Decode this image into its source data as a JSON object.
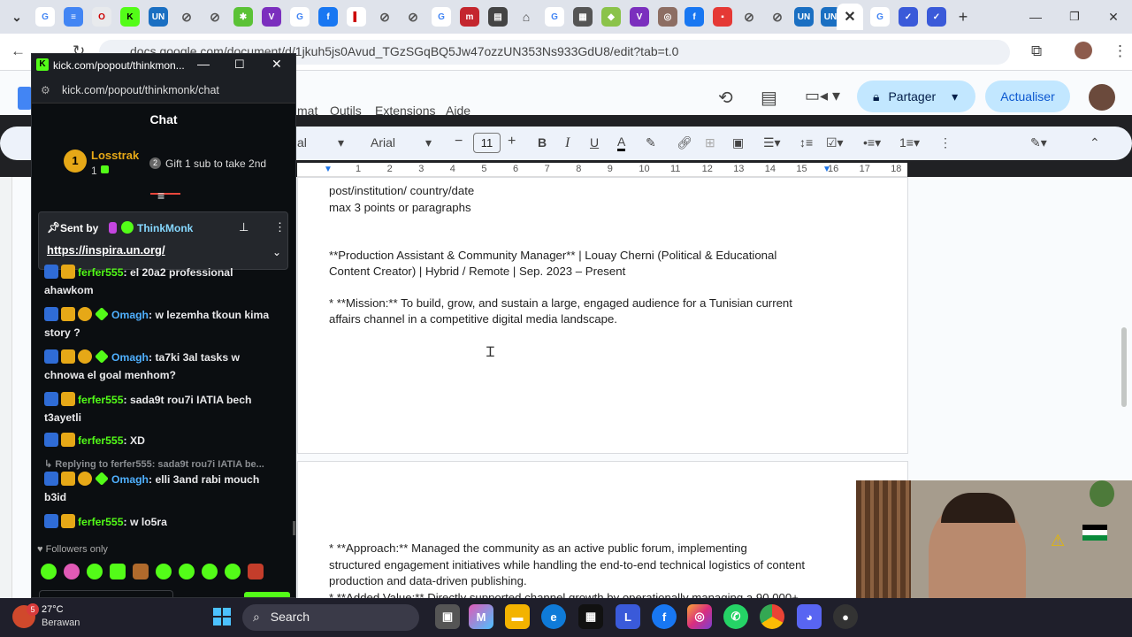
{
  "browser": {
    "url": "docs.google.com/document/d/1jkuh5js0Avud_TGzSGqBQ5Jw47ozzUN353Ns933GdU8/edit?tab=t.0",
    "new_tab": "+",
    "win_min": "—",
    "win_max": "❐",
    "win_close": "✕"
  },
  "docs": {
    "menus": [
      "mat",
      "Outils",
      "Extensions",
      "Aide"
    ],
    "share_label": "Partager",
    "update_label": "Actualiser",
    "style_partial": "al",
    "font": "Arial",
    "font_size": "11",
    "ruler_ticks": [
      "1",
      "2",
      "3",
      "4",
      "5",
      "6",
      "7",
      "8",
      "9",
      "10",
      "11",
      "12",
      "13",
      "14",
      "15",
      "16",
      "17",
      "18"
    ],
    "lines_top": [
      "post/institution/ country/date",
      "max 3 points or paragraphs",
      "",
      "**Production Assistant & Community Manager** | Louay Cherni (Political & Educational",
      "Content Creator) | Hybrid / Remote | Sep. 2023 – Present",
      "",
      "*   **Mission:** To build, grow, and sustain a large, engaged audience for a Tunisian current",
      "affairs channel in a competitive digital media landscape."
    ],
    "lines_bottom": [
      "*   **Approach:** Managed the community as an active public forum, implementing",
      "structured engagement initiatives while handling the end-to-end technical logistics of content",
      "production and data-driven publishing.",
      "*   **Added Value:** Directly supported channel growth by operationally managing a 90,000+"
    ]
  },
  "chat": {
    "window_title": "kick.com/popout/thinkmon...",
    "url": "kick.com/popout/thinkmonk/chat",
    "header": "Chat",
    "leader_name": "Losstrak",
    "leader_count": "1",
    "gift_text": "Gift 1 sub to take 2nd",
    "pinned_prefix": "Sent by",
    "pinned_user": "ThinkMonk",
    "pinned_link": "https://inspira.un.org/",
    "messages": [
      {
        "user": "ferfer555",
        "text": "el 20a2 professional",
        "wrap": "ahawkom",
        "mod": false
      },
      {
        "user": "Omagh",
        "text": "w lezemha tkoun kima",
        "wrap": "story ?",
        "mod": true
      },
      {
        "user": "Omagh",
        "text": "ta7ki 3al tasks w",
        "wrap": "chnowa el goal menhom?",
        "mod": true
      },
      {
        "user": "ferfer555",
        "text": "sada9t rou7i IATIA bech",
        "wrap": "t3ayetli",
        "mod": false
      },
      {
        "user": "ferfer555",
        "text": "XD",
        "wrap": "",
        "mod": false
      },
      {
        "user": "Omagh",
        "text": "elli 3and rabi mouch",
        "wrap": "b3id",
        "mod": true
      },
      {
        "user": "ferfer555",
        "text": "w lo5ra",
        "wrap": "",
        "mod": false
      }
    ],
    "reply_hint": "Replying to ferfer555: sada9t rou7i IATIA be...",
    "followers_only": "Followers only"
  },
  "taskbar": {
    "weather_temp": "27°C",
    "weather_desc": "Berawan",
    "search": "Search",
    "notif": "5"
  }
}
